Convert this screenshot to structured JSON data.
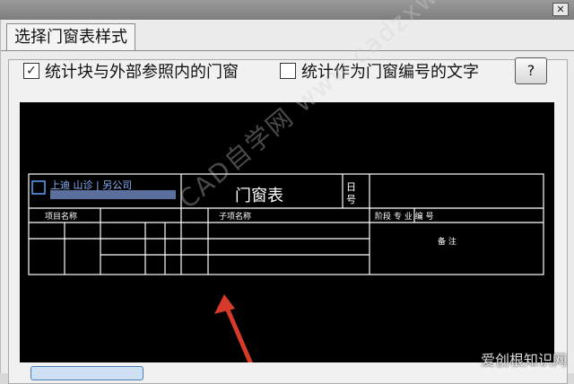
{
  "dialog": {
    "tab_label": "选择门窗表样式",
    "close_glyph": "✕"
  },
  "options": {
    "count_blocks": {
      "label": "统计块与外部参照内的门窗",
      "checked": true,
      "mark": "✓"
    },
    "count_text": {
      "label": "统计作为门窗编号的文字",
      "checked": false,
      "mark": ""
    },
    "help_label": "?"
  },
  "preview": {
    "table_title": "门窗表",
    "company_text": "上迪  山诊 | 另公司",
    "right_char_1": "日",
    "right_char_2": "号",
    "row2_left": "项目名称",
    "row2_mid": "子项名称",
    "row2_right": "阶段  专  业  编  号",
    "row3_note": "备  注"
  },
  "watermark": {
    "diagonal": "CAD自学网  www.cadzxw.com",
    "corner": "爱创根知识网"
  },
  "colors": {
    "preview_bg": "#000000",
    "line": "#ffffff",
    "checkbox_border": "#333333"
  }
}
